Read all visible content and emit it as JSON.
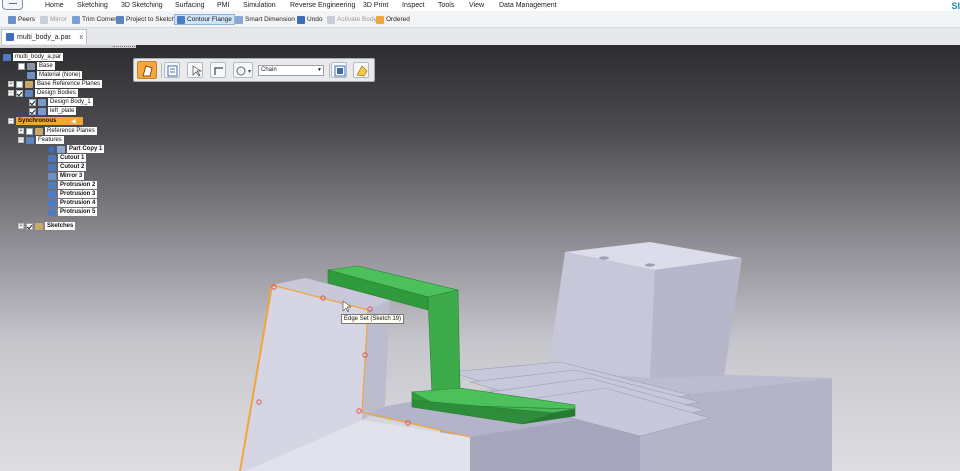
{
  "menu": {
    "tabs": [
      "Home",
      "Sketching",
      "3D Sketching",
      "Surfacing",
      "PMI",
      "Simulation",
      "Reverse Engineering",
      "3D Print",
      "Inspect",
      "Tools",
      "View",
      "Data Management"
    ],
    "brand": "SI"
  },
  "ribbon": {
    "commands": [
      {
        "label": "Peers",
        "icon": "peers-icon",
        "state": "normal"
      },
      {
        "label": "Mirror",
        "icon": "mirror-icon",
        "state": "disabled"
      },
      {
        "label": "Trim Corner",
        "icon": "trim-corner-icon",
        "state": "normal"
      },
      {
        "label": "Project to Sketch",
        "icon": "project-to-sketch-icon",
        "state": "normal"
      },
      {
        "label": "Contour Flange",
        "icon": "contour-flange-icon",
        "state": "active"
      },
      {
        "label": "Smart Dimension",
        "icon": "smart-dimension-icon",
        "state": "normal"
      },
      {
        "label": "Undo",
        "icon": "undo-icon",
        "state": "normal"
      },
      {
        "label": "Activate Body",
        "icon": "activate-body-icon",
        "state": "disabled"
      },
      {
        "label": "Ordered",
        "icon": "ordered-icon",
        "state": "normal"
      }
    ]
  },
  "document_tab": {
    "label": "multi_body_a.par",
    "close": "x"
  },
  "tree": {
    "root": "multi_body_a.par",
    "base": "Base",
    "material": "Material (None)",
    "base_reference_planes": "Base Reference Planes",
    "design_bodies": "Design Bodies",
    "design_body_1": "Design Body_1",
    "left_plate": "left_plate",
    "synchronous": "Synchronous",
    "reference_planes": "Reference Planes",
    "features": "Features",
    "part_copy_1": "Part Copy 1",
    "cutout_1": "Cutout 1",
    "cutout_2": "Cutout 2",
    "mirror_3": "Mirror 3",
    "protrusion_2": "Protrusion 2",
    "protrusion_3": "Protrusion 3",
    "protrusion_4": "Protrusion 4",
    "protrusion_5": "Protrusion 5",
    "sketches": "Sketches"
  },
  "command_bar": {
    "chain_option": "Chain"
  },
  "tooltip": "Edge Set (Sketch 19)",
  "colors": {
    "accent": "#f1a53a",
    "active_command": "#cfe3f7",
    "flange_green": "#38a845",
    "part_body": "#c9c9dc",
    "edge_highlight": "#f1a53a"
  }
}
